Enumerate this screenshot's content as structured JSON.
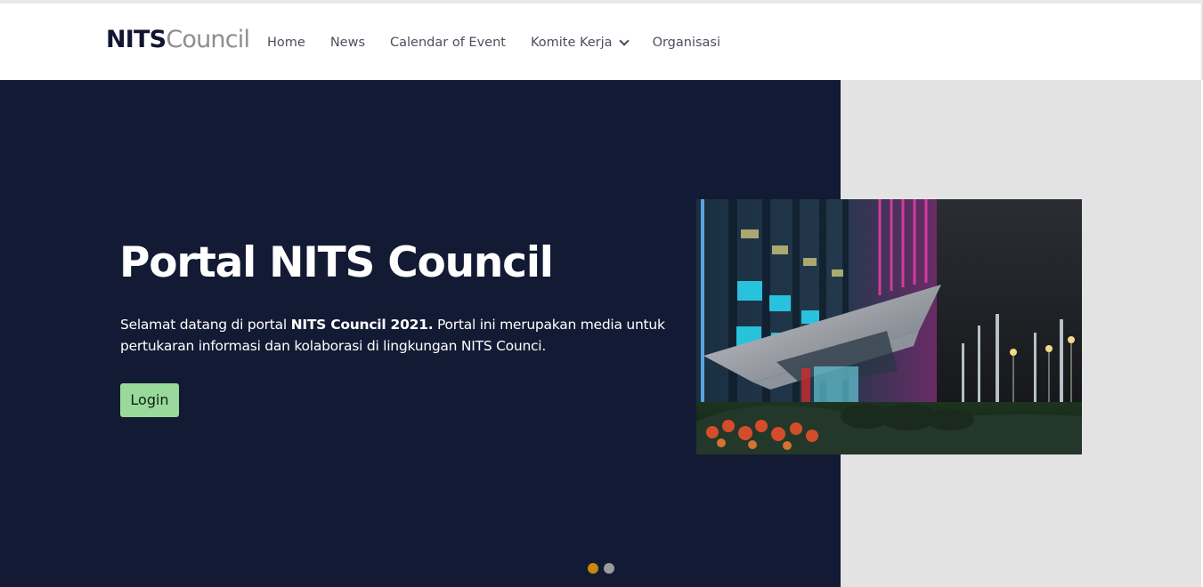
{
  "brand": {
    "name_strong": "NITS",
    "name_light": "Council"
  },
  "nav": {
    "items": [
      {
        "label": "Home",
        "has_dropdown": false
      },
      {
        "label": "News",
        "has_dropdown": false
      },
      {
        "label": "Calendar of Event",
        "has_dropdown": false
      },
      {
        "label": "Komite Kerja",
        "has_dropdown": true
      },
      {
        "label": "Organisasi",
        "has_dropdown": false
      }
    ]
  },
  "hero": {
    "title": "Portal NITS Council",
    "text_before": "Selamat datang di portal ",
    "text_strong": "NITS Council 2021.",
    "text_after": " Portal ini merupakan media untuk pertukaran informasi dan kolaborasi di lingkungan NITS Counci.",
    "login_label": "Login",
    "image_icon": "building-night-photo"
  },
  "slider": {
    "total_slides": 2,
    "active_index": 0
  },
  "colors": {
    "hero_background": "#131a34",
    "side_panel": "#e3e3e3",
    "login_button": "#99d99a",
    "active_dot": "#c88809",
    "inactive_dot": "#9a9a9f"
  }
}
